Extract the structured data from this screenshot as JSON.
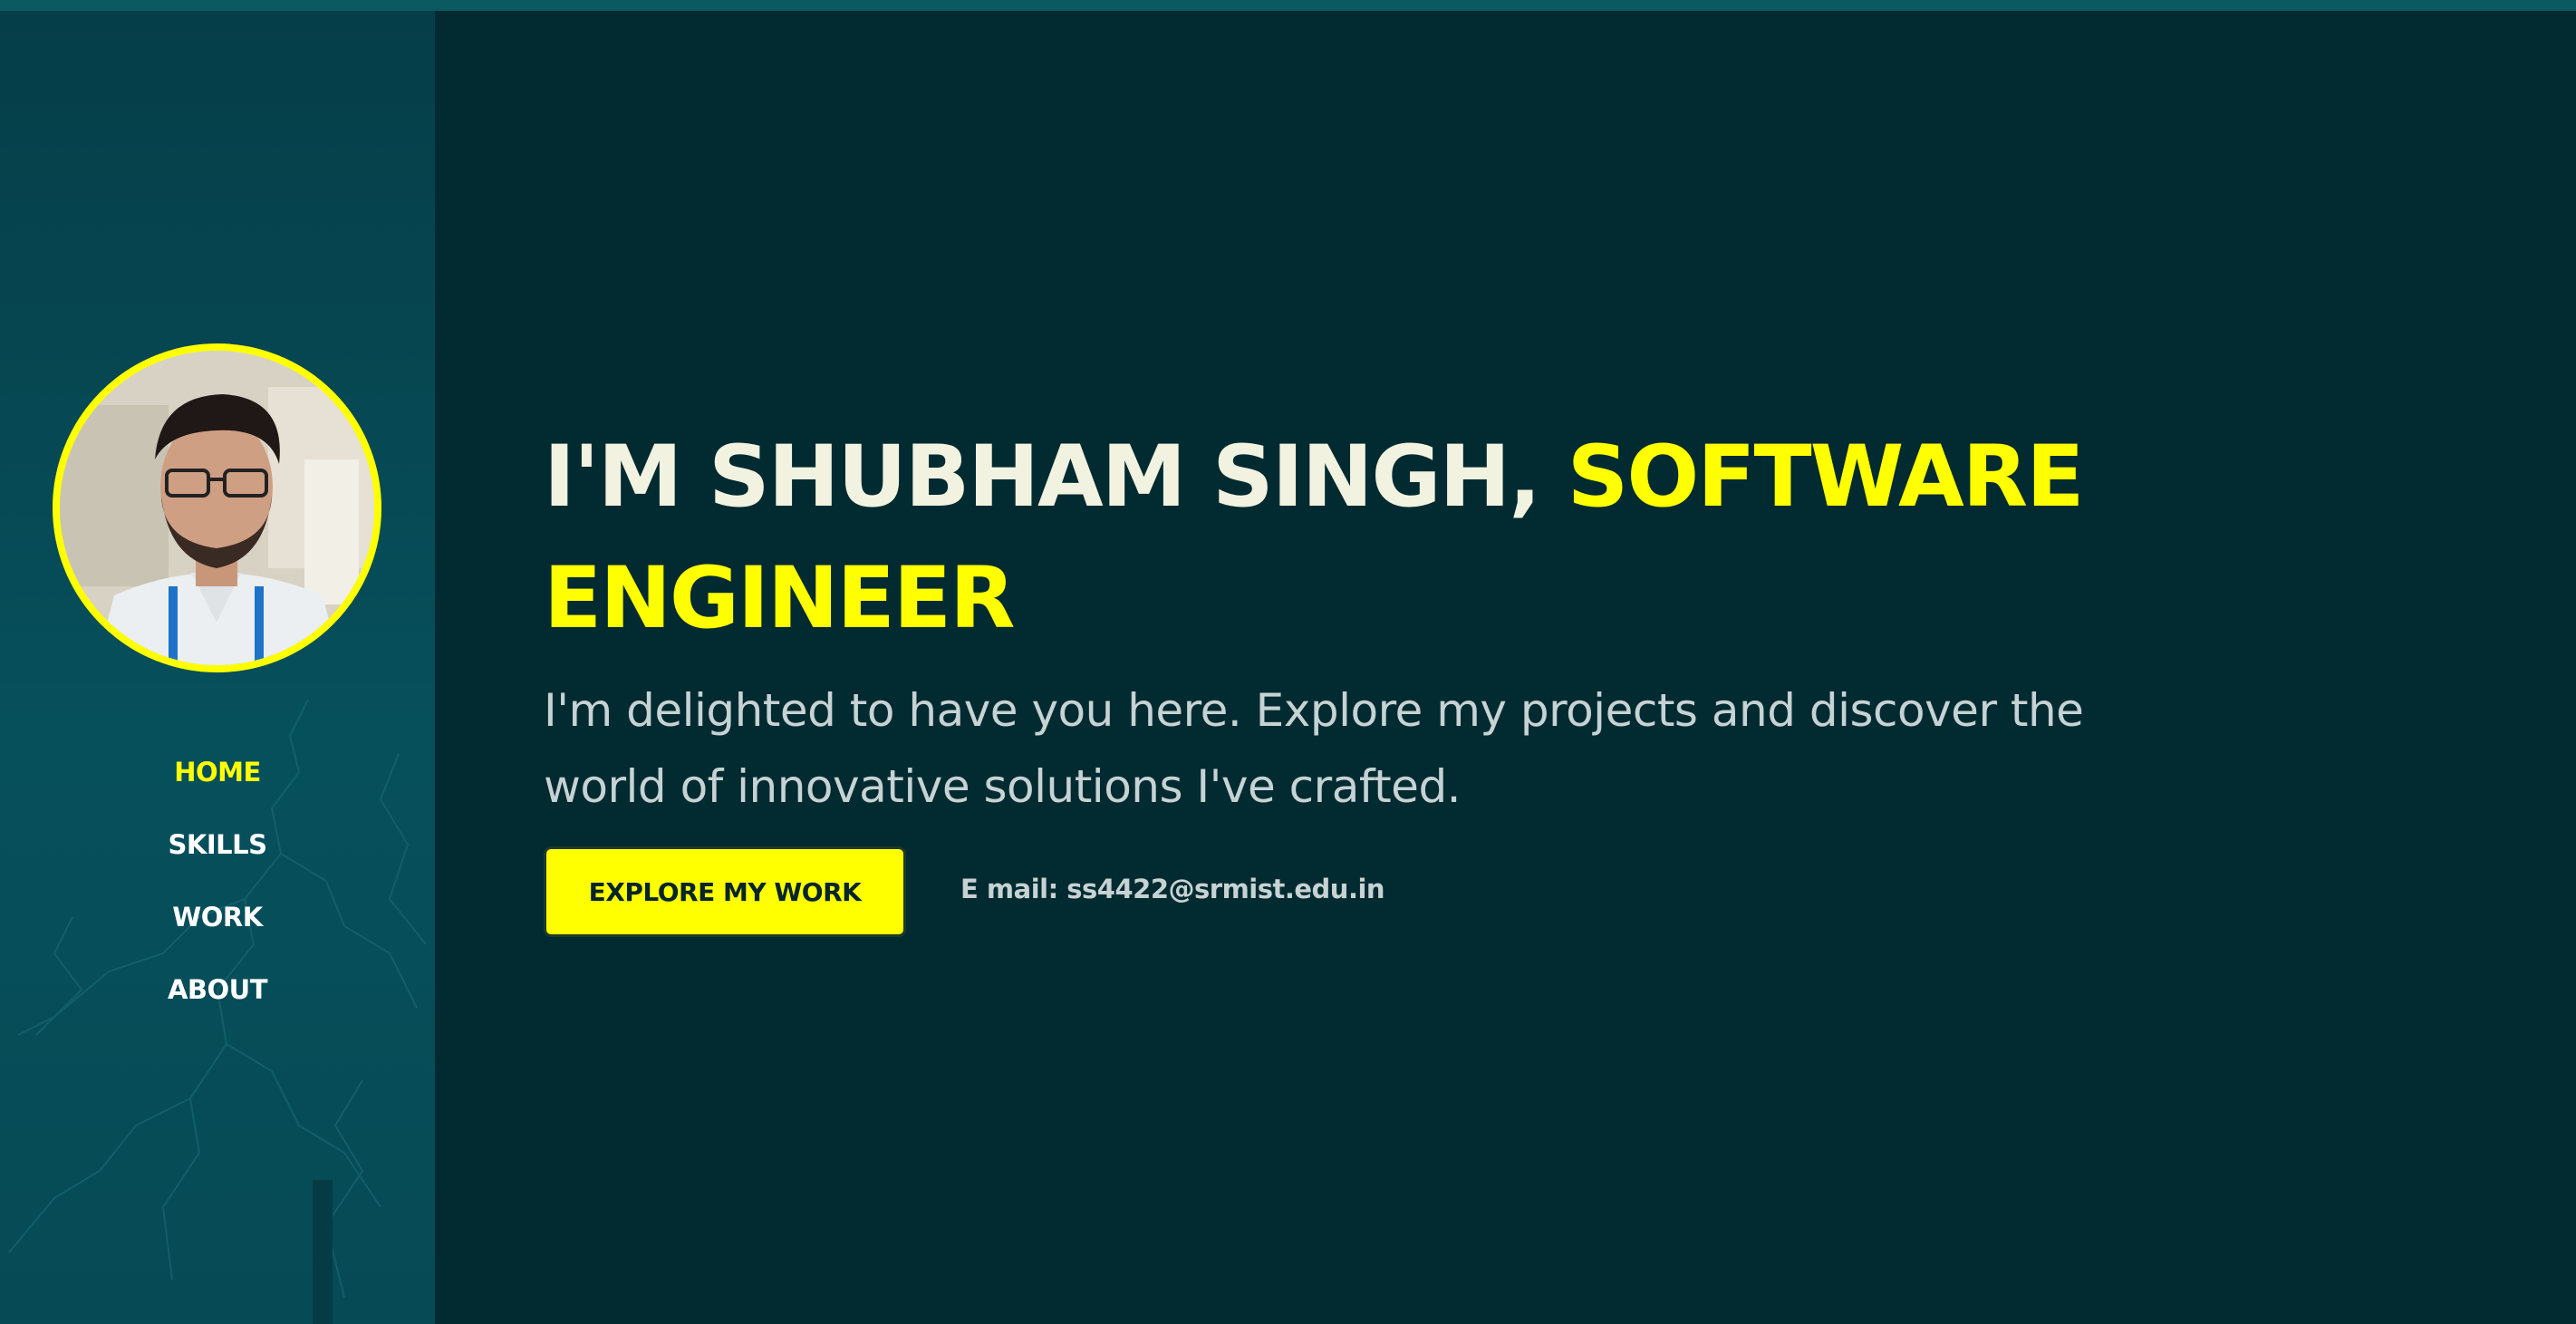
{
  "sidebar": {
    "avatar_alt": "profile photo",
    "nav": [
      {
        "label": "HOME",
        "active": true
      },
      {
        "label": "SKILLS",
        "active": false
      },
      {
        "label": "WORK",
        "active": false
      },
      {
        "label": "ABOUT",
        "active": false
      }
    ]
  },
  "hero": {
    "headline_plain": "I'M SHUBHAM SINGH, ",
    "headline_accent": "SOFTWARE ENGINEER",
    "intro": "I'm delighted to have you here. Explore my projects and discover the world of innovative solutions I've crafted.",
    "cta_label": "EXPLORE MY WORK",
    "email_text": "E mail: ss4422@srmist.edu.in"
  },
  "colors": {
    "background": "#022a31",
    "sidebar": "#053e48",
    "accent": "#ffff00",
    "headline": "#f1f3e0",
    "body_text": "#c6d2d3"
  }
}
